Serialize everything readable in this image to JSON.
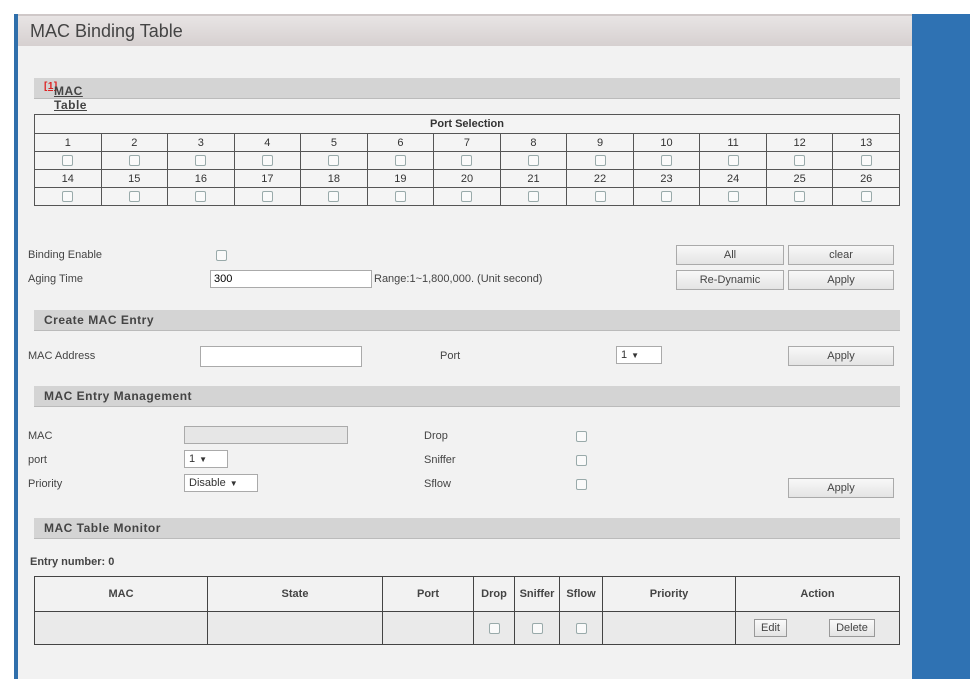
{
  "page": {
    "title": "MAC Binding Table"
  },
  "sections": {
    "binding": "MAC Table Binding",
    "binding_note": "[1]",
    "create": "Create MAC Entry",
    "management": "MAC Entry Management",
    "monitor": "MAC Table Monitor"
  },
  "ports": {
    "header": "Port Selection",
    "row1": [
      "1",
      "2",
      "3",
      "4",
      "5",
      "6",
      "7",
      "8",
      "9",
      "10",
      "11",
      "12",
      "13"
    ],
    "row2": [
      "14",
      "15",
      "16",
      "17",
      "18",
      "19",
      "20",
      "21",
      "22",
      "23",
      "24",
      "25",
      "26"
    ]
  },
  "binding": {
    "enable_label": "Binding Enable",
    "aging_label": "Aging Time",
    "aging_value": "300",
    "range_text": "Range:1~1,800,000. (Unit second)",
    "all_btn": "All",
    "clear_btn": "clear",
    "redynamic_btn": "Re-Dynamic",
    "apply_btn": "Apply"
  },
  "create": {
    "mac_label": "MAC Address",
    "mac_value": "",
    "port_label": "Port",
    "port_value": "1",
    "apply_btn": "Apply"
  },
  "management": {
    "mac_label": "MAC",
    "port_label": "port",
    "port_value": "1",
    "priority_label": "Priority",
    "priority_value": "Disable",
    "drop_label": "Drop",
    "sniffer_label": "Sniffer",
    "sflow_label": "Sflow",
    "apply_btn": "Apply"
  },
  "monitor": {
    "entry_label": "Entry number: 0",
    "columns": [
      "MAC",
      "State",
      "Port",
      "Drop",
      "Sniffer",
      "Sflow",
      "Priority",
      "Action"
    ],
    "edit_btn": "Edit",
    "delete_btn": "Delete"
  }
}
